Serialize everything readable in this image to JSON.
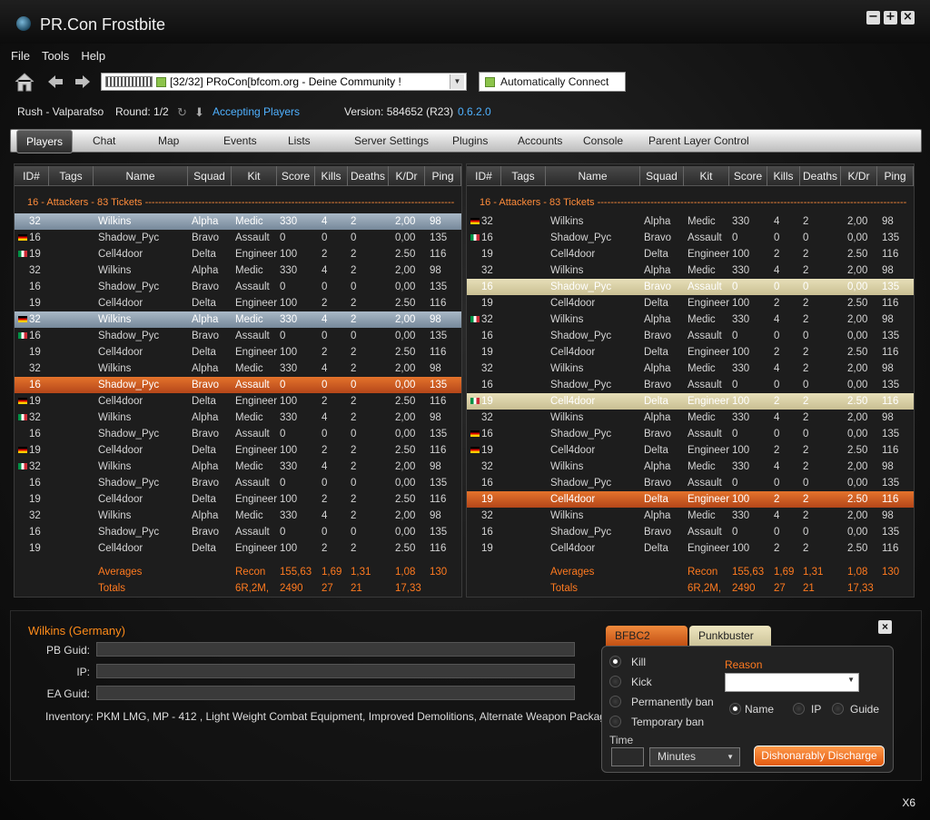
{
  "app": {
    "title": "PR.Con Frostbite",
    "win_min": "−",
    "win_max": "+",
    "win_close": "×"
  },
  "menu": [
    "File",
    "Tools",
    "Help"
  ],
  "server": {
    "name": "[32/32] PRoCon[bfcom.org - Deine Community !",
    "auto_connect": "Automatically Connect"
  },
  "status": {
    "map": "Rush - Valparafso",
    "round": "Round: 1/2",
    "state": "Accepting Players",
    "version": "Version: 584652 (R23)",
    "build": "0.6.2.0"
  },
  "tabs": [
    "Players",
    "Chat",
    "Map",
    "Events",
    "Lists",
    "Server Settings",
    "Plugins",
    "Accounts",
    "Console",
    "Parent Layer Control"
  ],
  "columns": [
    "ID#",
    "Tags",
    "Name",
    "Squad",
    "Kit",
    "Score",
    "Kills",
    "Deaths",
    "K/Dr",
    "Ping"
  ],
  "team_header": "16 - Attackers - 83 Tickets ------------------------------------------------------------------------------------------------------",
  "left_rows": [
    [
      "",
      "32",
      "Wilkins",
      "Alpha",
      "Medic",
      "330",
      "4",
      "2",
      "2,00",
      "98"
    ],
    [
      "de",
      "16",
      "Shadow_Pyc",
      "Bravo",
      "Assault",
      "0",
      "0",
      "0",
      "0,00",
      "135"
    ],
    [
      "it",
      "19",
      "Cell4door",
      "Delta",
      "Engineer",
      "100",
      "2",
      "2",
      "2.50",
      "116"
    ],
    [
      "",
      "32",
      "Wilkins",
      "Alpha",
      "Medic",
      "330",
      "4",
      "2",
      "2,00",
      "98"
    ],
    [
      "",
      "16",
      "Shadow_Pyc",
      "Bravo",
      "Assault",
      "0",
      "0",
      "0",
      "0,00",
      "135"
    ],
    [
      "",
      "19",
      "Cell4door",
      "Delta",
      "Engineer",
      "100",
      "2",
      "2",
      "2.50",
      "116"
    ],
    [
      "de",
      "32",
      "Wilkins",
      "Alpha",
      "Medic",
      "330",
      "4",
      "2",
      "2,00",
      "98"
    ],
    [
      "it",
      "16",
      "Shadow_Pyc",
      "Bravo",
      "Assault",
      "0",
      "0",
      "0",
      "0,00",
      "135"
    ],
    [
      "",
      "19",
      "Cell4door",
      "Delta",
      "Engineer",
      "100",
      "2",
      "2",
      "2.50",
      "116"
    ],
    [
      "",
      "32",
      "Wilkins",
      "Alpha",
      "Medic",
      "330",
      "4",
      "2",
      "2,00",
      "98"
    ],
    [
      "",
      "16",
      "Shadow_Pyc",
      "Bravo",
      "Assault",
      "0",
      "0",
      "0",
      "0,00",
      "135"
    ],
    [
      "de",
      "19",
      "Cell4door",
      "Delta",
      "Engineer",
      "100",
      "2",
      "2",
      "2.50",
      "116"
    ],
    [
      "it",
      "32",
      "Wilkins",
      "Alpha",
      "Medic",
      "330",
      "4",
      "2",
      "2,00",
      "98"
    ],
    [
      "",
      "16",
      "Shadow_Pyc",
      "Bravo",
      "Assault",
      "0",
      "0",
      "0",
      "0,00",
      "135"
    ],
    [
      "de",
      "19",
      "Cell4door",
      "Delta",
      "Engineer",
      "100",
      "2",
      "2",
      "2.50",
      "116"
    ],
    [
      "it",
      "32",
      "Wilkins",
      "Alpha",
      "Medic",
      "330",
      "4",
      "2",
      "2,00",
      "98"
    ],
    [
      "",
      "16",
      "Shadow_Pyc",
      "Bravo",
      "Assault",
      "0",
      "0",
      "0",
      "0,00",
      "135"
    ],
    [
      "",
      "19",
      "Cell4door",
      "Delta",
      "Engineer",
      "100",
      "2",
      "2",
      "2.50",
      "116"
    ],
    [
      "",
      "32",
      "Wilkins",
      "Alpha",
      "Medic",
      "330",
      "4",
      "2",
      "2,00",
      "98"
    ],
    [
      "",
      "16",
      "Shadow_Pyc",
      "Bravo",
      "Assault",
      "0",
      "0",
      "0",
      "0,00",
      "135"
    ],
    [
      "",
      "19",
      "Cell4door",
      "Delta",
      "Engineer",
      "100",
      "2",
      "2",
      "2.50",
      "116"
    ]
  ],
  "left_highlight": {
    "0": "sel-blue",
    "6": "sel-blue",
    "10": "sel-orange"
  },
  "right_rows": [
    [
      "de",
      "32",
      "Wilkins",
      "Alpha",
      "Medic",
      "330",
      "4",
      "2",
      "2,00",
      "98"
    ],
    [
      "it",
      "16",
      "Shadow_Pyc",
      "Bravo",
      "Assault",
      "0",
      "0",
      "0",
      "0,00",
      "135"
    ],
    [
      "",
      "19",
      "Cell4door",
      "Delta",
      "Engineer",
      "100",
      "2",
      "2",
      "2.50",
      "116"
    ],
    [
      "",
      "32",
      "Wilkins",
      "Alpha",
      "Medic",
      "330",
      "4",
      "2",
      "2,00",
      "98"
    ],
    [
      "",
      "16",
      "Shadow_Pyc",
      "Bravo",
      "Assault",
      "0",
      "0",
      "0",
      "0,00",
      "135"
    ],
    [
      "",
      "19",
      "Cell4door",
      "Delta",
      "Engineer",
      "100",
      "2",
      "2",
      "2.50",
      "116"
    ],
    [
      "it",
      "32",
      "Wilkins",
      "Alpha",
      "Medic",
      "330",
      "4",
      "2",
      "2,00",
      "98"
    ],
    [
      "",
      "16",
      "Shadow_Pyc",
      "Bravo",
      "Assault",
      "0",
      "0",
      "0",
      "0,00",
      "135"
    ],
    [
      "",
      "19",
      "Cell4door",
      "Delta",
      "Engineer",
      "100",
      "2",
      "2",
      "2.50",
      "116"
    ],
    [
      "",
      "32",
      "Wilkins",
      "Alpha",
      "Medic",
      "330",
      "4",
      "2",
      "2,00",
      "98"
    ],
    [
      "",
      "16",
      "Shadow_Pyc",
      "Bravo",
      "Assault",
      "0",
      "0",
      "0",
      "0,00",
      "135"
    ],
    [
      "it",
      "19",
      "Cell4door",
      "Delta",
      "Engineer",
      "100",
      "2",
      "2",
      "2.50",
      "116"
    ],
    [
      "",
      "32",
      "Wilkins",
      "Alpha",
      "Medic",
      "330",
      "4",
      "2",
      "2,00",
      "98"
    ],
    [
      "de",
      "16",
      "Shadow_Pyc",
      "Bravo",
      "Assault",
      "0",
      "0",
      "0",
      "0,00",
      "135"
    ],
    [
      "de",
      "19",
      "Cell4door",
      "Delta",
      "Engineer",
      "100",
      "2",
      "2",
      "2.50",
      "116"
    ],
    [
      "",
      "32",
      "Wilkins",
      "Alpha",
      "Medic",
      "330",
      "4",
      "2",
      "2,00",
      "98"
    ],
    [
      "",
      "16",
      "Shadow_Pyc",
      "Bravo",
      "Assault",
      "0",
      "0",
      "0",
      "0,00",
      "135"
    ],
    [
      "",
      "19",
      "Cell4door",
      "Delta",
      "Engineer",
      "100",
      "2",
      "2",
      "2.50",
      "116"
    ],
    [
      "",
      "32",
      "Wilkins",
      "Alpha",
      "Medic",
      "330",
      "4",
      "2",
      "2,00",
      "98"
    ],
    [
      "",
      "16",
      "Shadow_Pyc",
      "Bravo",
      "Assault",
      "0",
      "0",
      "0",
      "0,00",
      "135"
    ],
    [
      "",
      "19",
      "Cell4door",
      "Delta",
      "Engineer",
      "100",
      "2",
      "2",
      "2.50",
      "116"
    ]
  ],
  "right_highlight": {
    "4": "sel-cream",
    "11": "sel-cream",
    "17": "sel-orange"
  },
  "averages": {
    "label": "Averages",
    "kit": "Recon",
    "score": "155,63",
    "kills": "1,69",
    "deaths": "1,31",
    "kdr": "1,08",
    "ping": "130"
  },
  "totals": {
    "label": "Totals",
    "kit": "6R,2M,",
    "score": "2490",
    "kills": "27",
    "deaths": "21",
    "kdr": "17,33"
  },
  "player": {
    "name": "Wilkins  (Germany)",
    "pb_label": "PB Guid:",
    "ip_label": "IP:",
    "ea_label": "EA Guid:",
    "inventory": "Inventory:  PKM LMG, MP - 412 , Light Weight Combat Equipment, Improved Demolitions, Alternate Weapon Package"
  },
  "punish": {
    "tab1": "BFBC2",
    "tab2": "Punkbuster",
    "kill": "Kill",
    "kick": "Kick",
    "perm": "Permanently ban",
    "temp": "Temporary ban",
    "reason": "Reason",
    "opt_name": "Name",
    "opt_ip": "IP",
    "opt_guid": "Guide",
    "time": "Time",
    "unit": "Minutes",
    "action": "Dishonarably Discharge"
  },
  "footer": "X6",
  "colors": {
    "accent": "#ff7a1f",
    "selected_blue": "#8fa2b4",
    "selected_orange": "#d45b22",
    "selected_cream": "#ddd3a8"
  }
}
